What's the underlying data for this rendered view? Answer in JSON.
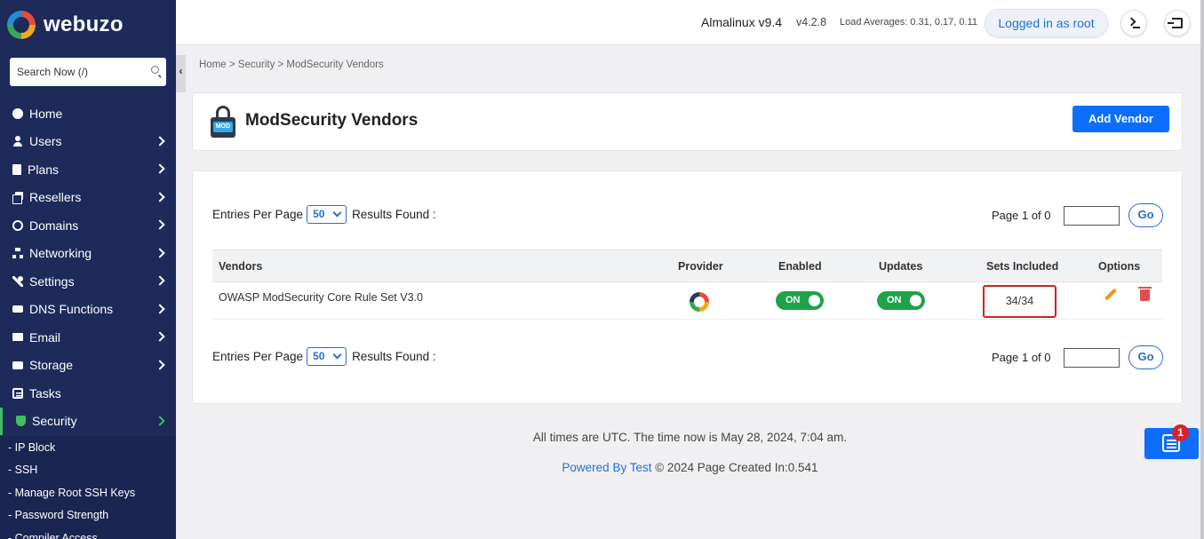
{
  "brand": {
    "name": "webuzo"
  },
  "search": {
    "placeholder": "Search Now (/)"
  },
  "sidebar": {
    "items": [
      {
        "label": "Home",
        "icon": "home-icon",
        "has_chevron": false
      },
      {
        "label": "Users",
        "icon": "user-icon",
        "has_chevron": true
      },
      {
        "label": "Plans",
        "icon": "book-icon",
        "has_chevron": true
      },
      {
        "label": "Resellers",
        "icon": "clone-icon",
        "has_chevron": true
      },
      {
        "label": "Domains",
        "icon": "globe-icon",
        "has_chevron": true
      },
      {
        "label": "Networking",
        "icon": "network-icon",
        "has_chevron": true
      },
      {
        "label": "Settings",
        "icon": "wrench-icon",
        "has_chevron": true
      },
      {
        "label": "DNS Functions",
        "icon": "dns-icon",
        "has_chevron": true
      },
      {
        "label": "Email",
        "icon": "envelope-icon",
        "has_chevron": true
      },
      {
        "label": "Storage",
        "icon": "hdd-icon",
        "has_chevron": true
      },
      {
        "label": "Tasks",
        "icon": "list-icon",
        "has_chevron": false
      },
      {
        "label": "Security",
        "icon": "shield-icon",
        "has_chevron": true,
        "active": true
      }
    ],
    "sub_items": [
      {
        "label": "- IP Block"
      },
      {
        "label": "- SSH"
      },
      {
        "label": "- Manage Root SSH Keys"
      },
      {
        "label": "- Password Strength"
      },
      {
        "label": "- Compiler Access"
      }
    ],
    "accent_color": "#3fbf5e",
    "bg_color": "#1e2a5a"
  },
  "topbar": {
    "os": "Almalinux v9.4",
    "version": "v4.2.8",
    "load": "Load Averages: 0.31, 0.17, 0.11",
    "logged_in": "Logged in as root"
  },
  "breadcrumb": "Home > Security > ModSecurity Vendors",
  "page": {
    "title": "ModSecurity Vendors",
    "icon_tag": "MOD",
    "add_button": "Add Vendor"
  },
  "listing": {
    "entries_label": "Entries Per Page",
    "entries_value": "50",
    "results_label": "Results Found :",
    "page_info": "Page 1 of 0",
    "go_label": "Go",
    "columns": [
      "Vendors",
      "Provider",
      "Enabled",
      "Updates",
      "Sets Included",
      "Options"
    ],
    "rows": [
      {
        "vendor": "OWASP ModSecurity Core Rule Set V3.0",
        "enabled": "ON",
        "updates": "ON",
        "sets": "34/34"
      }
    ]
  },
  "footer": {
    "time": "All times are UTC. The time now is May 28, 2024, 7:04 am.",
    "powered_link": "Powered By Test",
    "credit_rest": "© 2024  Page Created In:0.541"
  },
  "news": {
    "badge": "1"
  },
  "colors": {
    "primary": "#0d6efd",
    "toggle_on": "#1fa34a",
    "highlight": "#d42020"
  }
}
